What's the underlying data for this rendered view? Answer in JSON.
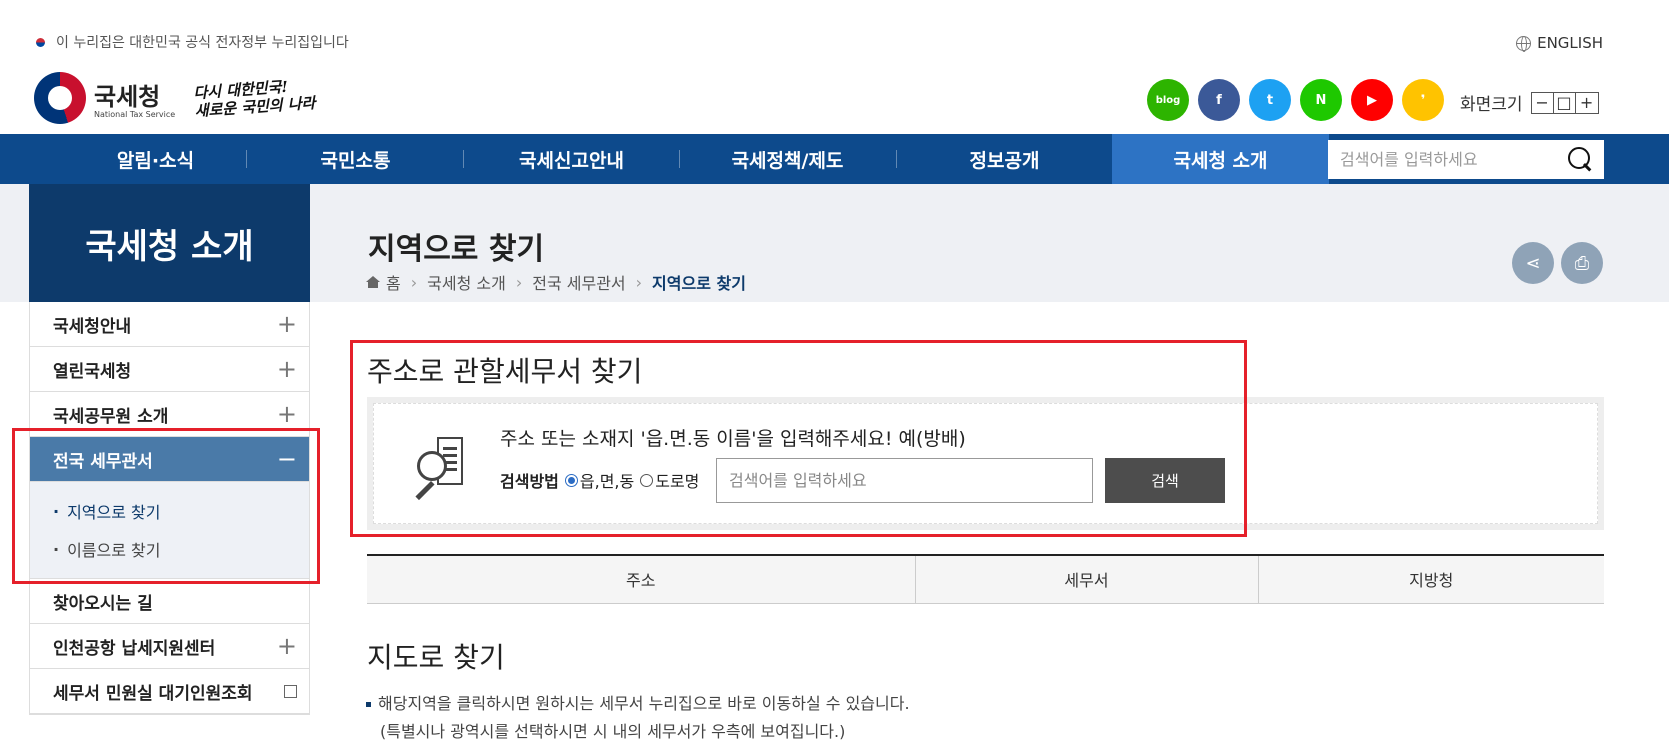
{
  "header": {
    "gov_banner": "이 누리집은 대한민국 공식 전자정부 누리집입니다",
    "english": "ENGLISH",
    "logo_ko": "국세청",
    "logo_en": "National Tax Service",
    "slogan_line1": "다시 대한민국!",
    "slogan_line2": "새로운 국민의 나라",
    "sns": [
      {
        "name": "blog-icon",
        "label": "blog",
        "color": "#2db400"
      },
      {
        "name": "facebook-icon",
        "label": "f",
        "color": "#3b5998"
      },
      {
        "name": "twitter-icon",
        "label": "t",
        "color": "#1da1f2"
      },
      {
        "name": "post-icon",
        "label": "N",
        "color": "#1ec800"
      },
      {
        "name": "youtube-icon",
        "label": "▶",
        "color": "#ff0000"
      },
      {
        "name": "kakaostory-icon",
        "label": "❜",
        "color": "#ffc300"
      }
    ],
    "font_size_label": "화면크기",
    "font_size_controls": [
      "−",
      "□",
      "+"
    ]
  },
  "nav": {
    "items": [
      "알림·소식",
      "국민소통",
      "국세신고안내",
      "국세정책/제도",
      "정보공개",
      "국세청 소개"
    ],
    "active_index": 5,
    "search_placeholder": "검색어를 입력하세요"
  },
  "sidebar": {
    "title": "국세청 소개",
    "items": [
      {
        "label": "국세청안내",
        "toggle": "+"
      },
      {
        "label": "열린국세청",
        "toggle": "+"
      },
      {
        "label": "국세공무원 소개",
        "toggle": "+"
      },
      {
        "label": "전국 세무관서",
        "toggle": "−",
        "active": true
      },
      {
        "label": "찾아오시는 길",
        "toggle": ""
      },
      {
        "label": "인천공항 납세지원센터",
        "toggle": "+"
      },
      {
        "label": "세무서 민원실 대기인원조회",
        "toggle": "external"
      }
    ],
    "sub_items": [
      "지역으로 찾기",
      "이름으로 찾기"
    ]
  },
  "page": {
    "title": "지역으로 찾기",
    "breadcrumb": [
      "홈",
      "국세청 소개",
      "전국 세무관서",
      "지역으로 찾기"
    ]
  },
  "address_search": {
    "title": "주소로 관할세무서 찾기",
    "guide": "주소 또는 소재지 '읍.면.동 이름'을 입력해주세요! 예(방배)",
    "method_label": "검색방법",
    "options": [
      "읍,면,동",
      "도로명"
    ],
    "selected_option": "읍,면,동",
    "placeholder": "검색어를 입력하세요",
    "button": "검색"
  },
  "result_table": {
    "headers": [
      "주소",
      "세무서",
      "지방청"
    ]
  },
  "map_section": {
    "title": "지도로 찾기",
    "note_line1": "해당지역을 클릭하시면 원하시는 세무서 누리집으로 바로 이동하실 수 있습니다.",
    "note_line2": "(특별시나 광역시를 선택하시면 시 내의 세무서가 우측에 보여집니다.)"
  },
  "colors": {
    "nav_bg": "#0d4a8c",
    "nav_active": "#2d73c4",
    "sidebar_title_bg": "#0d3a6b",
    "sidebar_active_bg": "#4a7aa8",
    "highlight_red": "#e5202a"
  }
}
